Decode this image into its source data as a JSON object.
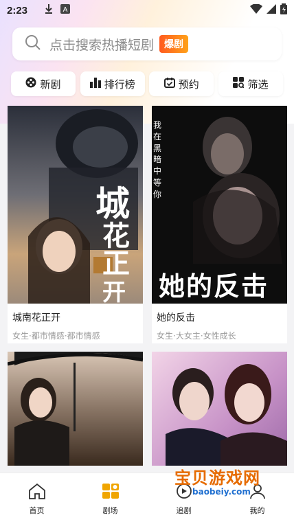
{
  "status_bar": {
    "time": "2:23"
  },
  "search": {
    "placeholder": "点击搜索热播短剧",
    "badge": "爆剧"
  },
  "chips": [
    {
      "label": "新剧",
      "icon": "film-reel-icon"
    },
    {
      "label": "排行榜",
      "icon": "bar-chart-icon"
    },
    {
      "label": "预约",
      "icon": "calendar-icon"
    },
    {
      "label": "筛选",
      "icon": "filter-grid-icon"
    }
  ],
  "dramas": [
    {
      "title": "城南花正开",
      "tags": "女生·都市情感·都市情感",
      "poster_text": [
        "城",
        "花",
        "正",
        "开"
      ],
      "poster_colors": [
        "#2b2f3a",
        "#c9a47a"
      ]
    },
    {
      "title": "她的反击",
      "tags": "女生·大女主·女性成长",
      "poster_text": [
        "我在黑暗中等你",
        "她的反击"
      ],
      "poster_colors": [
        "#111111",
        "#5a4a4a"
      ]
    },
    {
      "title": "",
      "tags": "",
      "poster_colors": [
        "#3a2a1e",
        "#d9c6b5"
      ]
    },
    {
      "title": "",
      "tags": "",
      "poster_colors": [
        "#c792c7",
        "#f2d4e7"
      ]
    }
  ],
  "tabbar": [
    {
      "label": "首页",
      "icon": "home-icon"
    },
    {
      "label": "剧场",
      "icon": "theater-icon"
    },
    {
      "label": "追剧",
      "icon": "follow-icon"
    },
    {
      "label": "我的",
      "icon": "profile-icon"
    }
  ],
  "watermark": {
    "main": "宝贝游戏网",
    "sub": "baobeiy.com"
  },
  "colors": {
    "accent": "#f0a500",
    "badge_start": "#ff5a1f",
    "badge_end": "#ffa21a"
  }
}
